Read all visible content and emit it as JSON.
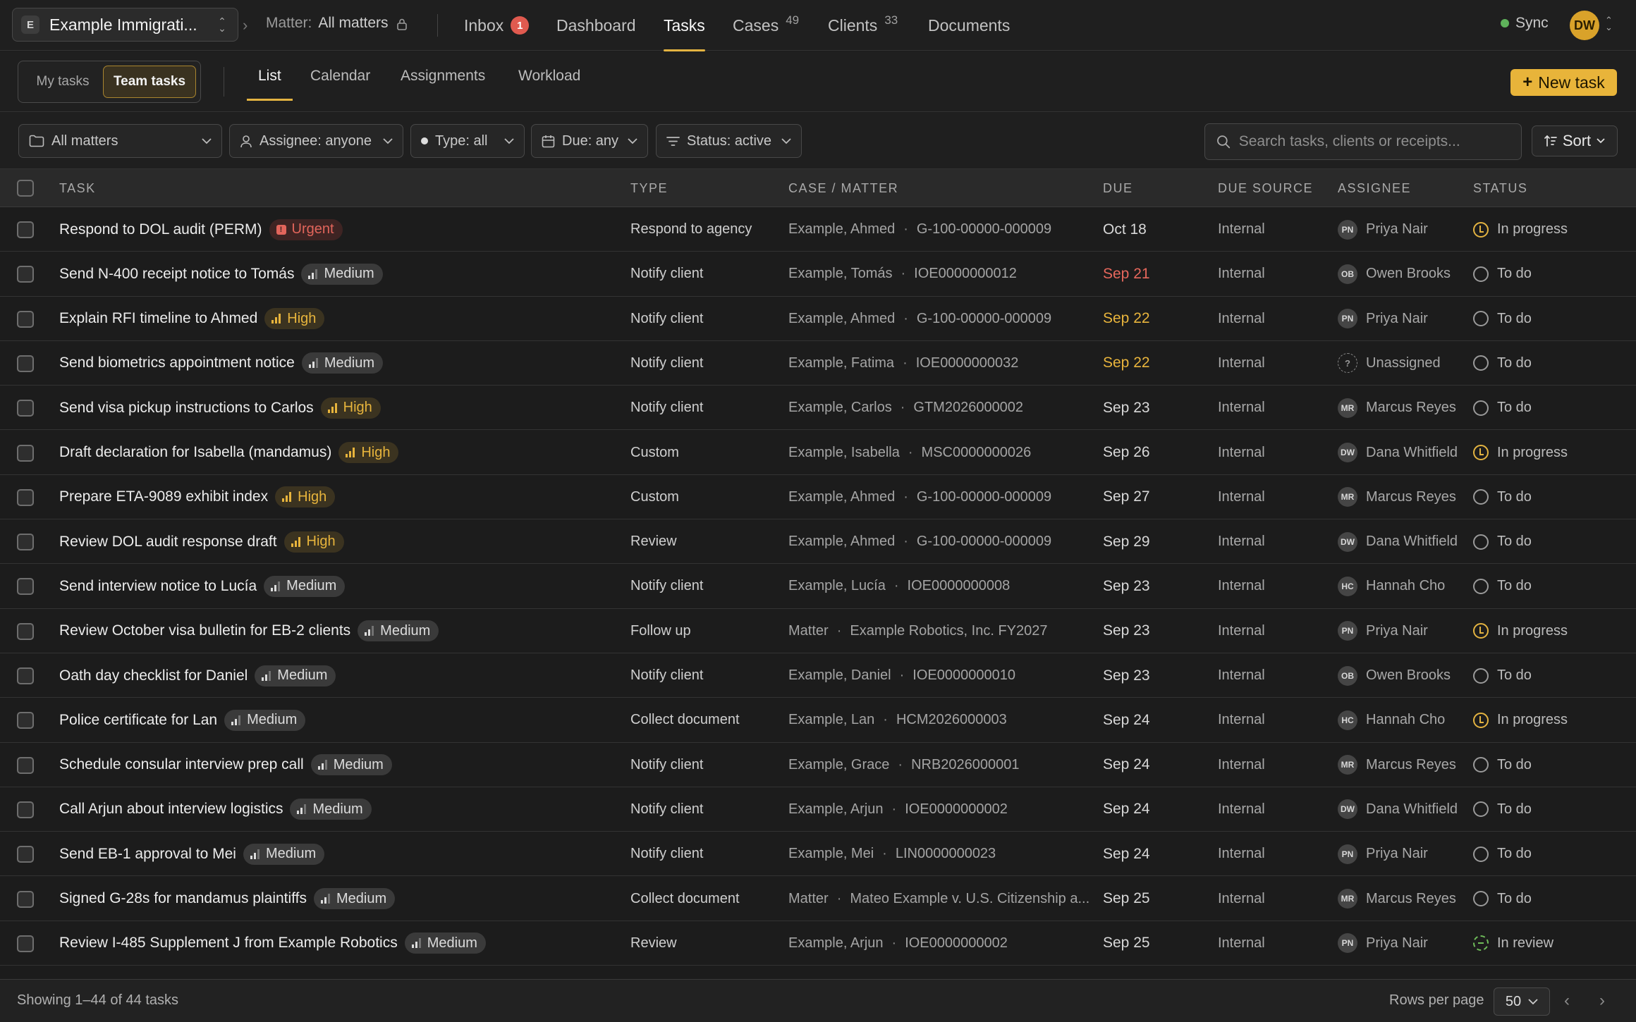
{
  "topbar": {
    "workspace_letter": "E",
    "workspace_name": "Example Immigrati...",
    "matter_label": "Matter:",
    "matter_value": "All matters",
    "nav": [
      {
        "label": "Inbox",
        "badge": "1"
      },
      {
        "label": "Dashboard"
      },
      {
        "label": "Tasks",
        "active": true
      },
      {
        "label": "Cases",
        "count": "49"
      },
      {
        "label": "Clients",
        "count": "33"
      },
      {
        "label": "Documents"
      }
    ],
    "sync_label": "Sync",
    "user_initials": "DW"
  },
  "subbar": {
    "scope": {
      "mine": "My tasks",
      "team": "Team tasks"
    },
    "views": [
      "List",
      "Calendar",
      "Assignments",
      "Workload"
    ],
    "new_task": "New task"
  },
  "filters": {
    "matters": "All matters",
    "assignee": "Assignee: anyone",
    "type": "Type: all",
    "due": "Due: any",
    "status": "Status: active",
    "search_placeholder": "Search tasks, clients or receipts...",
    "sort": "Sort"
  },
  "table": {
    "headers": [
      "TASK",
      "TYPE",
      "CASE / MATTER",
      "DUE",
      "DUE SOURCE",
      "ASSIGNEE",
      "STATUS"
    ],
    "rows": [
      {
        "task": "Respond to DOL audit (PERM)",
        "priority": "Urgent",
        "ptype": "urgent",
        "type": "Respond to agency",
        "client": "Example, Ahmed",
        "case": "G-100-00000-000009",
        "due": "Oct 18",
        "due_tone": "",
        "source": "Internal",
        "initials": "PN",
        "assignee": "Priya Nair",
        "status": "In progress",
        "st": "prog"
      },
      {
        "task": "Send N-400 receipt notice to Tomás",
        "priority": "Medium",
        "ptype": "medium",
        "type": "Notify client",
        "client": "Example, Tomás",
        "case": "IOE0000000012",
        "due": "Sep 21",
        "due_tone": "red",
        "source": "Internal",
        "initials": "OB",
        "assignee": "Owen Brooks",
        "status": "To do",
        "st": "todo"
      },
      {
        "task": "Explain RFI timeline to Ahmed",
        "priority": "High",
        "ptype": "high",
        "type": "Notify client",
        "client": "Example, Ahmed",
        "case": "G-100-00000-000009",
        "due": "Sep 22",
        "due_tone": "amber",
        "source": "Internal",
        "initials": "PN",
        "assignee": "Priya Nair",
        "status": "To do",
        "st": "todo"
      },
      {
        "task": "Send biometrics appointment notice",
        "priority": "Medium",
        "ptype": "medium",
        "type": "Notify client",
        "client": "Example, Fatima",
        "case": "IOE0000000032",
        "due": "Sep 22",
        "due_tone": "amber",
        "source": "Internal",
        "initials": "?",
        "assignee": "Unassigned",
        "status": "To do",
        "st": "todo"
      },
      {
        "task": "Send visa pickup instructions to Carlos",
        "priority": "High",
        "ptype": "high",
        "type": "Notify client",
        "client": "Example, Carlos",
        "case": "GTM2026000002",
        "due": "Sep 23",
        "due_tone": "",
        "source": "Internal",
        "initials": "MR",
        "assignee": "Marcus Reyes",
        "status": "To do",
        "st": "todo"
      },
      {
        "task": "Draft declaration for Isabella (mandamus)",
        "priority": "High",
        "ptype": "high",
        "type": "Custom",
        "client": "Example, Isabella",
        "case": "MSC0000000026",
        "due": "Sep 26",
        "due_tone": "",
        "source": "Internal",
        "initials": "DW",
        "assignee": "Dana Whitfield",
        "status": "In progress",
        "st": "prog"
      },
      {
        "task": "Prepare ETA-9089 exhibit index",
        "priority": "High",
        "ptype": "high",
        "type": "Custom",
        "client": "Example, Ahmed",
        "case": "G-100-00000-000009",
        "due": "Sep 27",
        "due_tone": "",
        "source": "Internal",
        "initials": "MR",
        "assignee": "Marcus Reyes",
        "status": "To do",
        "st": "todo"
      },
      {
        "task": "Review DOL audit response draft",
        "priority": "High",
        "ptype": "high",
        "type": "Review",
        "client": "Example, Ahmed",
        "case": "G-100-00000-000009",
        "due": "Sep 29",
        "due_tone": "",
        "source": "Internal",
        "initials": "DW",
        "assignee": "Dana Whitfield",
        "status": "To do",
        "st": "todo"
      },
      {
        "task": "Send interview notice to Lucía",
        "priority": "Medium",
        "ptype": "medium",
        "type": "Notify client",
        "client": "Example, Lucía",
        "case": "IOE0000000008",
        "due": "Sep 23",
        "due_tone": "",
        "source": "Internal",
        "initials": "HC",
        "assignee": "Hannah Cho",
        "status": "To do",
        "st": "todo"
      },
      {
        "task": "Review October visa bulletin for EB-2 clients",
        "priority": "Medium",
        "ptype": "medium",
        "type": "Follow up",
        "client": "Matter",
        "case": "Example Robotics, Inc. FY2027",
        "due": "Sep 23",
        "due_tone": "",
        "source": "Internal",
        "initials": "PN",
        "assignee": "Priya Nair",
        "status": "In progress",
        "st": "prog"
      },
      {
        "task": "Oath day checklist for Daniel",
        "priority": "Medium",
        "ptype": "medium",
        "type": "Notify client",
        "client": "Example, Daniel",
        "case": "IOE0000000010",
        "due": "Sep 23",
        "due_tone": "",
        "source": "Internal",
        "initials": "OB",
        "assignee": "Owen Brooks",
        "status": "To do",
        "st": "todo"
      },
      {
        "task": "Police certificate for Lan",
        "priority": "Medium",
        "ptype": "medium",
        "type": "Collect document",
        "client": "Example, Lan",
        "case": "HCM2026000003",
        "due": "Sep 24",
        "due_tone": "",
        "source": "Internal",
        "initials": "HC",
        "assignee": "Hannah Cho",
        "status": "In progress",
        "st": "prog"
      },
      {
        "task": "Schedule consular interview prep call",
        "priority": "Medium",
        "ptype": "medium",
        "type": "Notify client",
        "client": "Example, Grace",
        "case": "NRB2026000001",
        "due": "Sep 24",
        "due_tone": "",
        "source": "Internal",
        "initials": "MR",
        "assignee": "Marcus Reyes",
        "status": "To do",
        "st": "todo"
      },
      {
        "task": "Call Arjun about interview logistics",
        "priority": "Medium",
        "ptype": "medium",
        "type": "Notify client",
        "client": "Example, Arjun",
        "case": "IOE0000000002",
        "due": "Sep 24",
        "due_tone": "",
        "source": "Internal",
        "initials": "DW",
        "assignee": "Dana Whitfield",
        "status": "To do",
        "st": "todo"
      },
      {
        "task": "Send EB-1 approval to Mei",
        "priority": "Medium",
        "ptype": "medium",
        "type": "Notify client",
        "client": "Example, Mei",
        "case": "LIN0000000023",
        "due": "Sep 24",
        "due_tone": "",
        "source": "Internal",
        "initials": "PN",
        "assignee": "Priya Nair",
        "status": "To do",
        "st": "todo"
      },
      {
        "task": "Signed G-28s for mandamus plaintiffs",
        "priority": "Medium",
        "ptype": "medium",
        "type": "Collect document",
        "client": "Matter",
        "case": "Mateo Example v. U.S. Citizenship a...",
        "due": "Sep 25",
        "due_tone": "",
        "source": "Internal",
        "initials": "MR",
        "assignee": "Marcus Reyes",
        "status": "To do",
        "st": "todo"
      },
      {
        "task": "Review I-485 Supplement J from Example Robotics",
        "priority": "Medium",
        "ptype": "medium",
        "type": "Review",
        "client": "Example, Arjun",
        "case": "IOE0000000002",
        "due": "Sep 25",
        "due_tone": "",
        "source": "Internal",
        "initials": "PN",
        "assignee": "Priya Nair",
        "status": "In review",
        "st": "rev"
      }
    ]
  },
  "footer": {
    "showing": "Showing 1–44 of 44 tasks",
    "rows_per_page_label": "Rows per page",
    "rows_per_page_value": "50"
  },
  "colors": {
    "accent": "#e3b341",
    "urgent": "#e2655b",
    "background": "#1c1c1c"
  }
}
